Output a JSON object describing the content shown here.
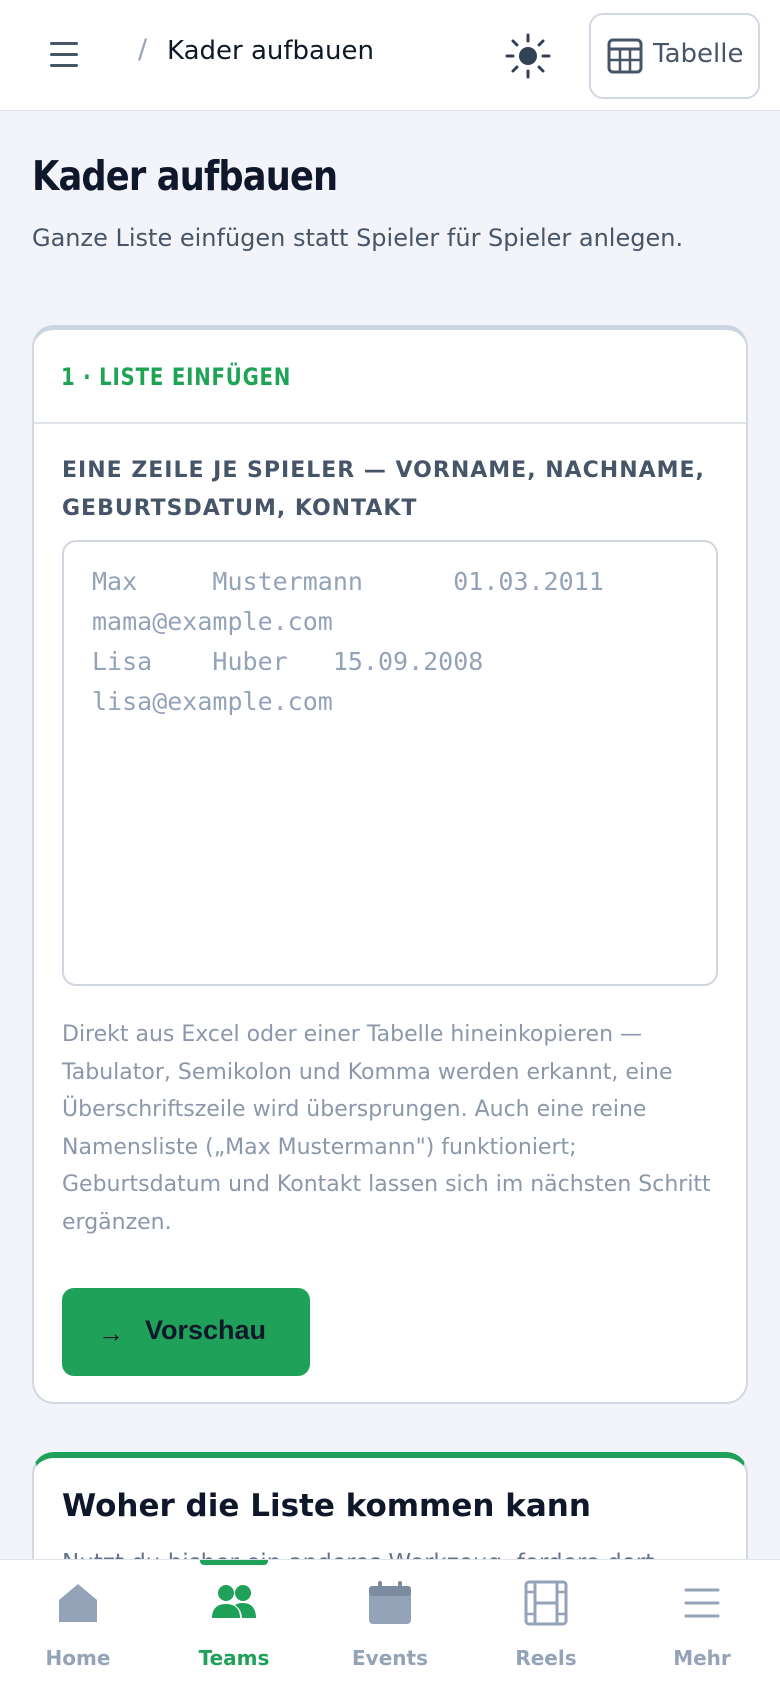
{
  "header": {
    "breadcrumb_separator": "/",
    "breadcrumb_title": "Kader aufbauen",
    "table_button_label": "Tabelle"
  },
  "page": {
    "title": "Kader aufbauen",
    "subtitle": "Ganze Liste einfügen statt Spieler für Spieler anlegen."
  },
  "step_card": {
    "heading": "1 · LISTE EINFÜGEN",
    "field_label": "EINE ZEILE JE SPIELER — VORNAME, NACHNAME, GEBURTSDATUM, KONTAKT",
    "textarea_placeholder": "Max\tMustermann\t01.03.2011\tmama@example.com\nLisa\tHuber\t15.09.2008\tlisa@example.com",
    "help_text": "Direkt aus Excel oder einer Tabelle hineinkopieren — Tabulator, Semikolon und Komma werden erkannt, eine Überschriftszeile wird übersprungen. Auch eine reine Namensliste („Max Mustermann\") funktioniert; Geburtsdatum und Kontakt lassen sich im nächsten Schritt ergänzen.",
    "preview_button_arrow": "→",
    "preview_button_label": "Vorschau"
  },
  "source_card": {
    "title": "Woher die Liste kommen kann",
    "text": "Nutzt du bisher ein anderes Werkzeug, fordere dort"
  },
  "bottom_nav": {
    "items": [
      {
        "label": "Home",
        "icon": "home-icon",
        "active": false
      },
      {
        "label": "Teams",
        "icon": "teams-icon",
        "active": true
      },
      {
        "label": "Events",
        "icon": "calendar-icon",
        "active": false
      },
      {
        "label": "Reels",
        "icon": "film-icon",
        "active": false
      },
      {
        "label": "Mehr",
        "icon": "menu-icon",
        "active": false
      }
    ]
  },
  "colors": {
    "accent": "#1fa15a",
    "text_dark": "#0f172a",
    "text_muted": "#94a3b8"
  }
}
